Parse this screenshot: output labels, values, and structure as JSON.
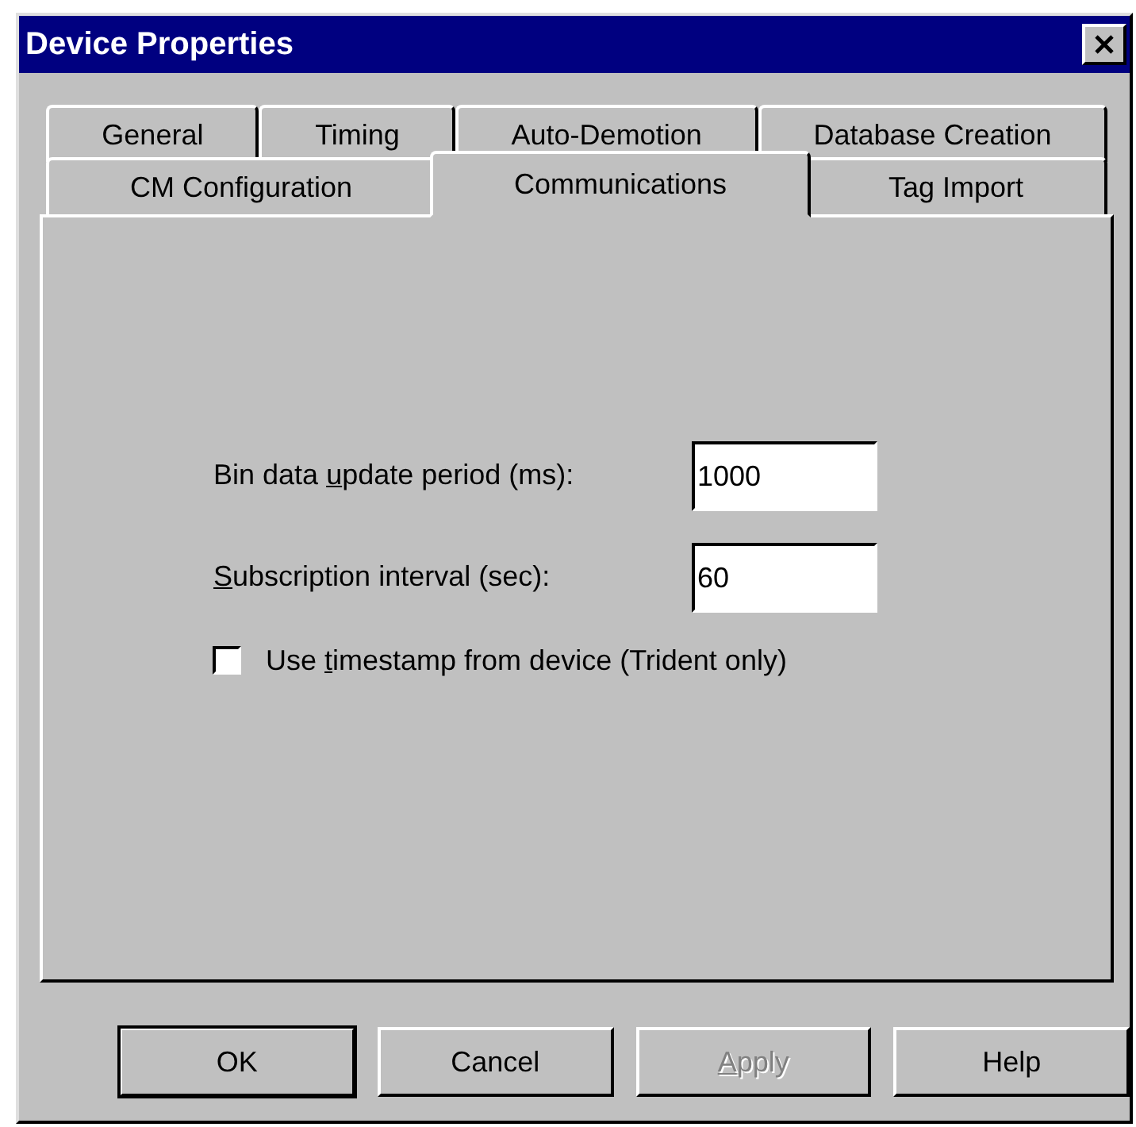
{
  "window": {
    "title": "Device Properties"
  },
  "tab_rows": [
    [
      {
        "label": "General",
        "selected": false
      },
      {
        "label": "Timing",
        "selected": false
      },
      {
        "label": "Auto-Demotion",
        "selected": false
      },
      {
        "label": "Database Creation",
        "selected": false
      }
    ],
    [
      {
        "label": "CM Configuration",
        "selected": false
      },
      {
        "label": "Communications",
        "selected": true
      },
      {
        "label": "Tag Import",
        "selected": false
      }
    ]
  ],
  "fields": [
    {
      "label": [
        {
          "text": "Bin data "
        },
        {
          "text": "u",
          "underlined": true
        },
        {
          "text": "pdate period (ms):"
        }
      ],
      "value": "1000"
    },
    {
      "label": [
        {
          "text": "S",
          "underlined": true
        },
        {
          "text": "ubscription interval (sec):"
        }
      ],
      "value": "60"
    }
  ],
  "checkbox": {
    "checked": false,
    "label": [
      {
        "text": "Use "
      },
      {
        "text": "t",
        "underlined": true
      },
      {
        "text": "imestamp from device (Trident only)"
      }
    ]
  },
  "buttons": [
    {
      "label": [
        {
          "text": "OK"
        }
      ],
      "default": true,
      "disabled": false
    },
    {
      "label": [
        {
          "text": "Cancel"
        }
      ],
      "default": false,
      "disabled": false
    },
    {
      "label": [
        {
          "text": "A",
          "underlined": true
        },
        {
          "text": "pply"
        }
      ],
      "default": false,
      "disabled": true
    },
    {
      "label": [
        {
          "text": "Help"
        }
      ],
      "default": false,
      "disabled": false
    }
  ]
}
